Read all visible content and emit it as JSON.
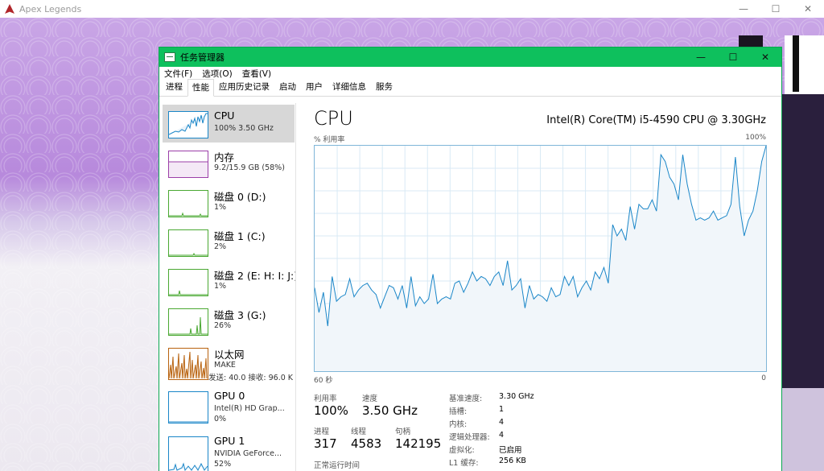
{
  "background_window": {
    "title": "Apex Legends",
    "controls": [
      "—",
      "☐",
      "✕"
    ]
  },
  "task_manager": {
    "title": "任务管理器",
    "window_controls": [
      "—",
      "☐",
      "✕"
    ],
    "menu": [
      "文件(F)",
      "选项(O)",
      "查看(V)"
    ],
    "tabs": [
      "进程",
      "性能",
      "应用历史记录",
      "启动",
      "用户",
      "详细信息",
      "服务"
    ],
    "active_tab": "性能",
    "sidebar": [
      {
        "name": "CPU",
        "sub": "100% 3.50 GHz",
        "color": "#1a86c8",
        "selected": true
      },
      {
        "name": "内存",
        "sub": "9.2/15.9 GB (58%)",
        "color": "#9b3ea8"
      },
      {
        "name": "磁盘 0 (D:)",
        "sub": "1%",
        "color": "#4aa832"
      },
      {
        "name": "磁盘 1 (C:)",
        "sub": "2%",
        "color": "#4aa832"
      },
      {
        "name": "磁盘 2 (E: H: I: J:)",
        "sub": "1%",
        "color": "#4aa832"
      },
      {
        "name": "磁盘 3 (G:)",
        "sub": "26%",
        "color": "#4aa832"
      },
      {
        "name": "以太网",
        "sub": "MAKE",
        "sub2": "发送: 40.0  接收: 96.0 K",
        "color": "#b8620e"
      },
      {
        "name": "GPU 0",
        "sub": "Intel(R) HD Grap...",
        "sub2": "0%",
        "color": "#1a86c8"
      },
      {
        "name": "GPU 1",
        "sub": "NVIDIA GeForce...",
        "sub2": "52%",
        "color": "#1a86c8"
      }
    ],
    "main": {
      "title": "CPU",
      "processor": "Intel(R) Core(TM) i5-4590 CPU @ 3.30GHz",
      "graph_label_top_left": "% 利用率",
      "graph_label_top_right": "100%",
      "graph_label_bottom_left": "60 秒",
      "graph_label_bottom_right": "0",
      "stats": {
        "utilization_label": "利用率",
        "utilization_value": "100%",
        "speed_label": "速度",
        "speed_value": "3.50 GHz",
        "processes_label": "进程",
        "processes_value": "317",
        "threads_label": "线程",
        "threads_value": "4583",
        "handles_label": "句柄",
        "handles_value": "142195",
        "uptime_label": "正常运行时间"
      },
      "specs": [
        {
          "label": "基准速度:",
          "value": "3.30 GHz"
        },
        {
          "label": "插槽:",
          "value": "1"
        },
        {
          "label": "内核:",
          "value": "4"
        },
        {
          "label": "逻辑处理器:",
          "value": "4"
        },
        {
          "label": "虚拟化:",
          "value": "已启用"
        },
        {
          "label": "L1 缓存:",
          "value": "256 KB"
        }
      ]
    }
  },
  "chart_data": {
    "type": "area",
    "title": "CPU",
    "ylabel": "% 利用率",
    "ylim": [
      0,
      100
    ],
    "xlim": [
      60,
      0
    ],
    "x_unit": "秒",
    "values": [
      37,
      26,
      35,
      20,
      42,
      31,
      33,
      34,
      41,
      33,
      36,
      38,
      39,
      36,
      34,
      28,
      33,
      38,
      37,
      32,
      38,
      28,
      42,
      29,
      33,
      30,
      32,
      43,
      30,
      32,
      33,
      32,
      39,
      40,
      35,
      39,
      44,
      40,
      42,
      41,
      38,
      42,
      44,
      38,
      49,
      36,
      38,
      41,
      28,
      38,
      32,
      34,
      33,
      31,
      37,
      33,
      34,
      42,
      38,
      42,
      33,
      37,
      40,
      36,
      44,
      41,
      46,
      39,
      65,
      60,
      63,
      58,
      73,
      63,
      74,
      72,
      72,
      76,
      71,
      96,
      93,
      86,
      83,
      76,
      96,
      83,
      74,
      67,
      68,
      67,
      68,
      71,
      67,
      68,
      69,
      74,
      95,
      73,
      60,
      67,
      71,
      80,
      93,
      100
    ],
    "color": "#1a86c8",
    "fill": "#f1f6fa",
    "grid": true
  }
}
